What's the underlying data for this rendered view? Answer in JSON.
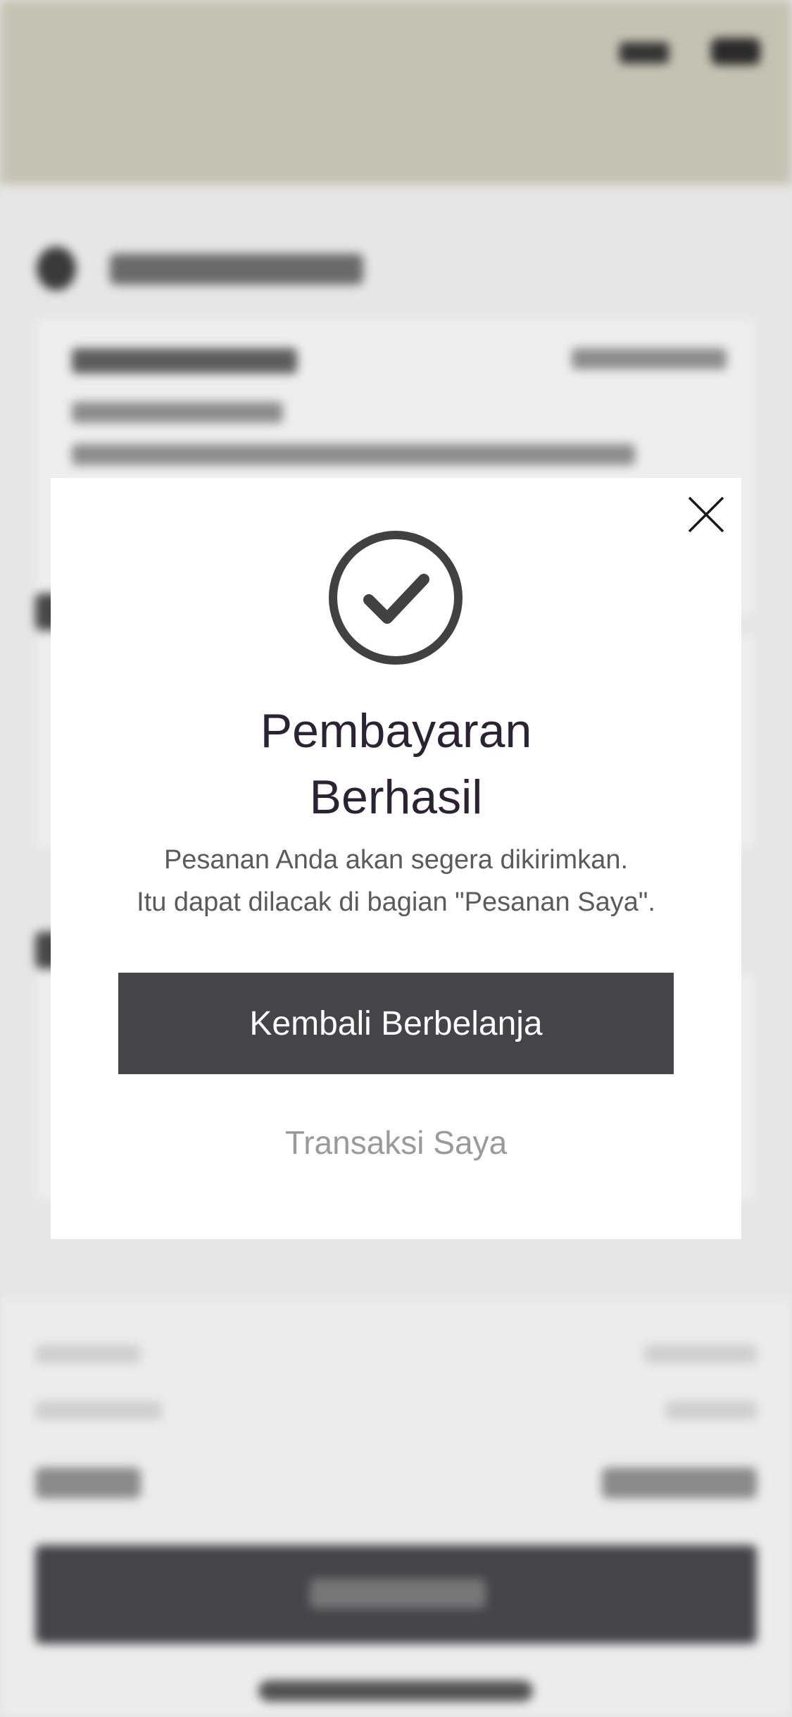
{
  "modal": {
    "title_line1": "Pembayaran",
    "title_line2": "Berhasil",
    "message_line1": "Pesanan Anda akan segera dikirimkan.",
    "message_line2": "Itu dapat dilacak di bagian \"Pesanan Saya\".",
    "primary_button": "Kembali Berbelanja",
    "secondary_link": "Transaksi Saya",
    "icons": {
      "success": "check-circle-icon",
      "close": "close-icon"
    }
  },
  "colors": {
    "header_bg": "#c4c3b3",
    "button_dark": "#454447",
    "title_text": "#2b2334",
    "link_gray": "#9a9a9a"
  }
}
